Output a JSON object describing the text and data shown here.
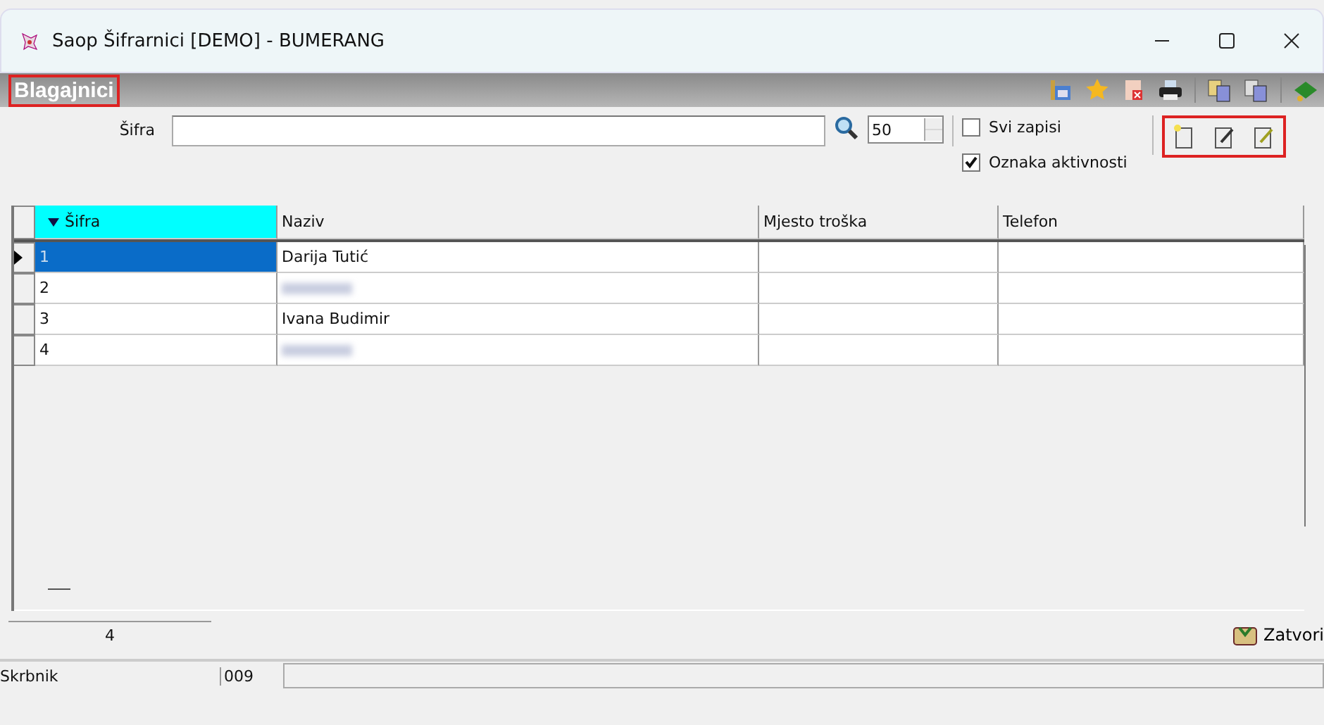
{
  "window": {
    "title": "Saop Šifrarnici [DEMO] - BUMERANG"
  },
  "header": {
    "title": "Blagajnici",
    "highlighted": true
  },
  "toolbar": {
    "highlighted": true
  },
  "search": {
    "label": "Šifra",
    "limit": "50"
  },
  "options": [
    {
      "label": "Svi zapisi",
      "checked": false
    },
    {
      "label": "Oznaka aktivnosti",
      "checked": true
    }
  ],
  "table": {
    "columns": [
      {
        "label": "Šifra",
        "sorted": true
      },
      {
        "label": "Naziv",
        "sorted": false
      },
      {
        "label": "Mjesto troška",
        "sorted": false
      },
      {
        "label": "Telefon",
        "sorted": false
      }
    ],
    "rows": [
      {
        "sifra": "1",
        "naziv": "Darija Tutić",
        "blurred": false,
        "selected": true
      },
      {
        "sifra": "2",
        "blurred": true,
        "selected": false
      },
      {
        "sifra": "3",
        "naziv": "Ivana Budimir",
        "blurred": false,
        "selected": false
      },
      {
        "sifra": "4",
        "blurred": true,
        "selected": false
      }
    ]
  },
  "count": "4",
  "close_button": "Zatvori",
  "status_bar": {
    "field_1": "Skrbnik",
    "field_2": "009"
  }
}
